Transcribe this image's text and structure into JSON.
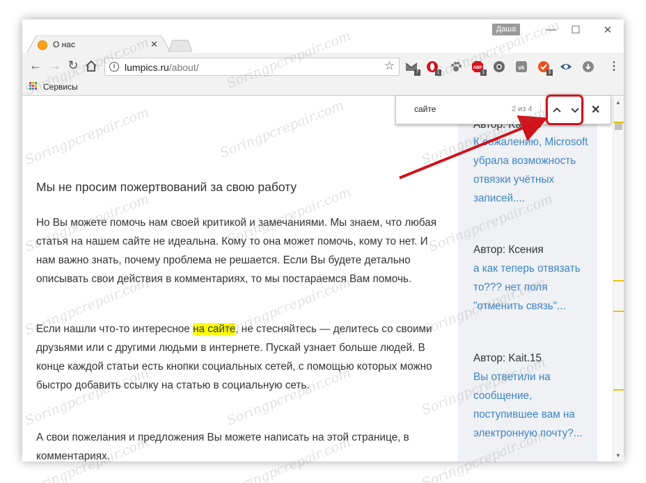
{
  "window": {
    "tab_title": "О нас",
    "user_name": "Даша",
    "controls": {
      "minimize": "—",
      "maximize": "☐",
      "close": "✕"
    }
  },
  "toolbar": {
    "url_host": "lumpics.ru",
    "url_path": "/about/",
    "extensions": [
      {
        "icon": "gmail-icon",
        "badge": "7"
      },
      {
        "icon": "opera-red-icon",
        "badge": "1"
      },
      {
        "icon": "paw-icon",
        "badge": ""
      },
      {
        "icon": "adblock-icon",
        "badge": "1"
      },
      {
        "icon": "camera-icon",
        "badge": ""
      },
      {
        "icon": "vk-icon",
        "badge": ""
      },
      {
        "icon": "check-icon",
        "badge": "3"
      },
      {
        "icon": "eye-icon",
        "badge": ""
      },
      {
        "icon": "download-cloud-icon",
        "badge": ""
      }
    ]
  },
  "bookmarks": {
    "apps_label": "Сервисы"
  },
  "find_bar": {
    "query": "сайте",
    "count": "2 из 4"
  },
  "article": {
    "heading": "Мы не просим пожертвований за свою работу",
    "paragraph1": "Но Вы можете помочь нам своей критикой и замечаниями. Мы знаем, что любая статья на нашем сайте не идеальна. Кому то она может помочь, кому то нет. И нам важно знать, почему проблема не решается. Если Вы будете детально описывать свои действия в комментариях, то мы постараемся Вам помочь.",
    "paragraph2_before": "Если нашли что-то интересное ",
    "paragraph2_highlight": "на сайте",
    "paragraph2_after": ", не стесняйтесь — делитесь со своими друзьями или с другими людьми в интернете. Пускай узнает больше людей. В конце каждой статьи есть кнопки социальных сетей, с помощью которых можно быстро добавить ссылку на статью в социальную сеть.",
    "paragraph3": "А свои пожелания и предложения Вы можете написать на этой странице, в комментариях."
  },
  "sidebar": {
    "comments": [
      {
        "author": "Автор: Kait.15",
        "text": "К сожалению, Microsoft убрала возможность отвязки учётных записей...."
      },
      {
        "author": "Автор: Ксения",
        "text": "а как теперь отвязать то??? нет поля \"отменить связь\"..."
      },
      {
        "author": "Автор: Kait.15",
        "text": "Вы ответили на сообщение, поступившее вам на электронную почту?..."
      }
    ]
  },
  "watermark": "Soringpcrepair.com",
  "colors": {
    "accent_link": "#3d84c6",
    "search_highlight": "#ffff00",
    "annotation_red": "#d1121b",
    "sidebar_bg": "#eff1f4"
  }
}
